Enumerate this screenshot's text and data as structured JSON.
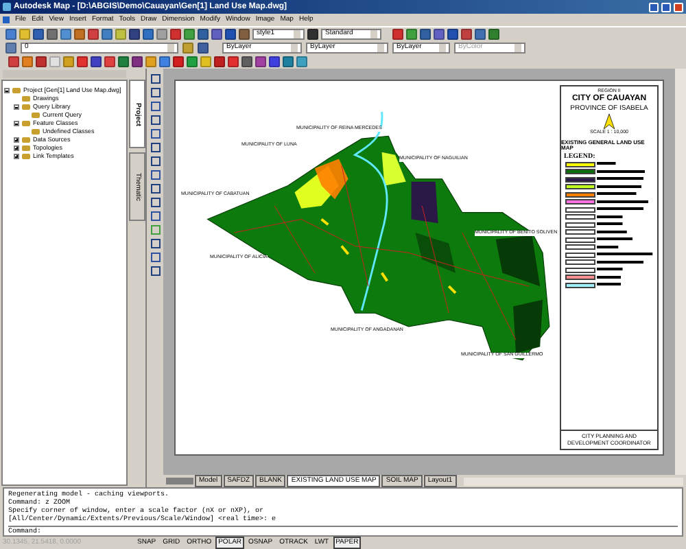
{
  "window": {
    "title": "Autodesk Map - [D:\\ABGIS\\Demo\\Cauayan\\Gen[1] Land Use Map.dwg]"
  },
  "menu": [
    "File",
    "Edit",
    "View",
    "Insert",
    "Format",
    "Tools",
    "Draw",
    "Dimension",
    "Modify",
    "Window",
    "Image",
    "Map",
    "Help"
  ],
  "toolbars": {
    "text_style": "style1",
    "dim_style": "Standard",
    "layer": "0",
    "color_setting": "ByLayer",
    "linetype": "ByLayer",
    "lineweight": "ByLayer",
    "plot_style": {
      "value": "ByColor",
      "disabled": true
    }
  },
  "palette": {
    "tabs": [
      {
        "label": "Project",
        "selected": true
      },
      {
        "label": "Thematic",
        "selected": false
      }
    ],
    "tree": [
      {
        "label": "Project [Gen[1] Land Use Map.dwg]",
        "expanded": true,
        "children": [
          {
            "label": "Drawings"
          },
          {
            "label": "Query Library",
            "expanded": true,
            "children": [
              {
                "label": "Current Query"
              }
            ]
          },
          {
            "label": "Feature Classes",
            "expanded": true,
            "children": [
              {
                "label": "Undefined Classes"
              }
            ]
          },
          {
            "label": "Data Sources",
            "expanded": false
          },
          {
            "label": "Topologies",
            "expanded": false
          },
          {
            "label": "Link Templates",
            "expanded": false
          }
        ]
      }
    ]
  },
  "map": {
    "labels": [
      "MUNICIPALITY OF REINA MERCEDES",
      "MUNICIPALITY OF LUNA",
      "MUNICIPALITY OF NAGUILIAN",
      "MUNICIPALITY OF CABATUAN",
      "MUNICIPALITY OF BENITO SOLIVEN",
      "MUNICIPALITY OF ALICIA",
      "MUNICIPALITY OF ANGADANAN",
      "MUNICIPALITY OF SAN GUILLERMO"
    ]
  },
  "legend": {
    "region": "REGION II",
    "city": "CITY OF CAUAYAN",
    "province": "PROVINCE OF ISABELA",
    "scale": "SCALE 1 : 10,000",
    "map_title": "EXISTING GENERAL LAND USE MAP",
    "heading": "LEGEND:",
    "footer": "CITY PLANNING AND DEVELOPMENT COORDINATOR",
    "entries": [
      {
        "color": "#ffff00"
      },
      {
        "color": "#0a6e0a"
      },
      {
        "color": "#2a1846"
      },
      {
        "color": "#c0ff20"
      },
      {
        "color": "#ff8000"
      },
      {
        "color": "#ff70e0"
      },
      {
        "color": "#ffffff"
      },
      {
        "color": "#ffffff"
      },
      {
        "color": "#ffffff"
      },
      {
        "color": "#ffffff"
      },
      {
        "color": "#ffffff"
      },
      {
        "color": "#ffffff"
      },
      {
        "color": "#ffffff"
      },
      {
        "color": "#ffffff"
      },
      {
        "color": "#ffffff"
      },
      {
        "color": "#ff9090"
      },
      {
        "color": "#a0f0ff"
      }
    ]
  },
  "layout_tabs": [
    {
      "label": "Model",
      "selected": false
    },
    {
      "label": "SAFDZ",
      "selected": false
    },
    {
      "label": "BLANK",
      "selected": false
    },
    {
      "label": "EXISTING LAND USE MAP",
      "selected": true
    },
    {
      "label": "SOIL MAP",
      "selected": false
    },
    {
      "label": "Layout1",
      "selected": false
    }
  ],
  "command": {
    "history": [
      "Regenerating model - caching viewports.",
      "Command: z ZOOM",
      "Specify corner of window, enter a scale factor (nX or nXP), or",
      "[All/Center/Dynamic/Extents/Previous/Scale/Window] <real time>: e"
    ],
    "prompt": "Command:"
  },
  "status": {
    "coordinates": "30.1345, 21.5418, 0.0000",
    "buttons": [
      {
        "label": "SNAP",
        "on": false
      },
      {
        "label": "GRID",
        "on": false
      },
      {
        "label": "ORTHO",
        "on": false
      },
      {
        "label": "POLAR",
        "on": true
      },
      {
        "label": "OSNAP",
        "on": false
      },
      {
        "label": "OTRACK",
        "on": false
      },
      {
        "label": "LWT",
        "on": false
      },
      {
        "label": "PAPER",
        "on": true
      }
    ]
  }
}
